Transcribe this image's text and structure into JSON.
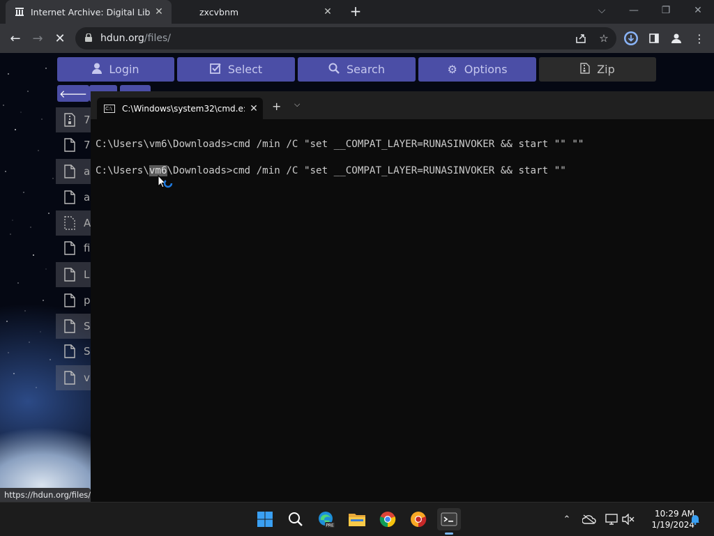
{
  "browser": {
    "tabs": [
      {
        "title": "Internet Archive: Digital Library of",
        "close": "✕",
        "active": true
      },
      {
        "title": "zxcvbnm",
        "close": "✕",
        "active": false
      }
    ],
    "new_tab": "+",
    "window_controls": {
      "dropdown": "⌵",
      "minimize": "—",
      "restore": "❐",
      "close": "✕"
    },
    "url": {
      "host": "hdun.org",
      "path": "/files/"
    },
    "nav": {
      "back": "←",
      "forward": "→",
      "stop": "✕"
    },
    "status_url": "https://hdun.org/files/a"
  },
  "site": {
    "menu": [
      {
        "label": "Login",
        "icon": "user-icon"
      },
      {
        "label": "Select",
        "icon": "checkbox-icon"
      },
      {
        "label": "Search",
        "icon": "search-icon"
      },
      {
        "label": "Options",
        "icon": "gear-icon"
      },
      {
        "label": "Zip",
        "icon": "archive-icon"
      }
    ],
    "back_arrow": "🡐",
    "files": [
      {
        "name": "7",
        "icon": "file-zip-icon"
      },
      {
        "name": "7",
        "icon": "file-icon"
      },
      {
        "name": "a",
        "icon": "file-icon"
      },
      {
        "name": "a",
        "icon": "file-icon"
      },
      {
        "name": "A",
        "icon": "file-dashed-icon"
      },
      {
        "name": "fi",
        "icon": "file-icon"
      },
      {
        "name": "L",
        "icon": "file-icon"
      },
      {
        "name": "p",
        "icon": "file-icon"
      },
      {
        "name": "S",
        "icon": "file-icon"
      },
      {
        "name": "S",
        "icon": "file-icon"
      },
      {
        "name": "v",
        "icon": "file-icon"
      }
    ]
  },
  "terminal": {
    "tab_title": "C:\\Windows\\system32\\cmd.e:",
    "tab_close": "✕",
    "plus": "+",
    "chevron": "⌵",
    "lines": [
      "C:\\Users\\vm6\\Downloads>cmd /min /C \"set __COMPAT_LAYER=RUNASINVOKER && start \"\" \"\"",
      {
        "pre": "C:\\Users\\",
        "selected": "vm6",
        "post": "\\Downloads>cmd /min /C \"set __COMPAT_LAYER=RUNASINVOKER && start \"\""
      }
    ]
  },
  "taskbar": {
    "apps": [
      "windows-start-icon",
      "search-icon",
      "edge-beta-icon",
      "file-explorer-icon",
      "chrome-icon",
      "chrome-canary-icon",
      "terminal-icon"
    ],
    "tray": [
      "chevron-up-icon",
      "onedrive-offline-icon",
      "network-icon",
      "volume-muted-icon"
    ],
    "time": "10:29 AM",
    "date": "1/19/2024",
    "notification_icon": "bell-icon"
  },
  "colors": {
    "menu_button": "#4b4ea6",
    "terminal_bg": "#0c0c0c",
    "chrome_dark": "#202124"
  }
}
